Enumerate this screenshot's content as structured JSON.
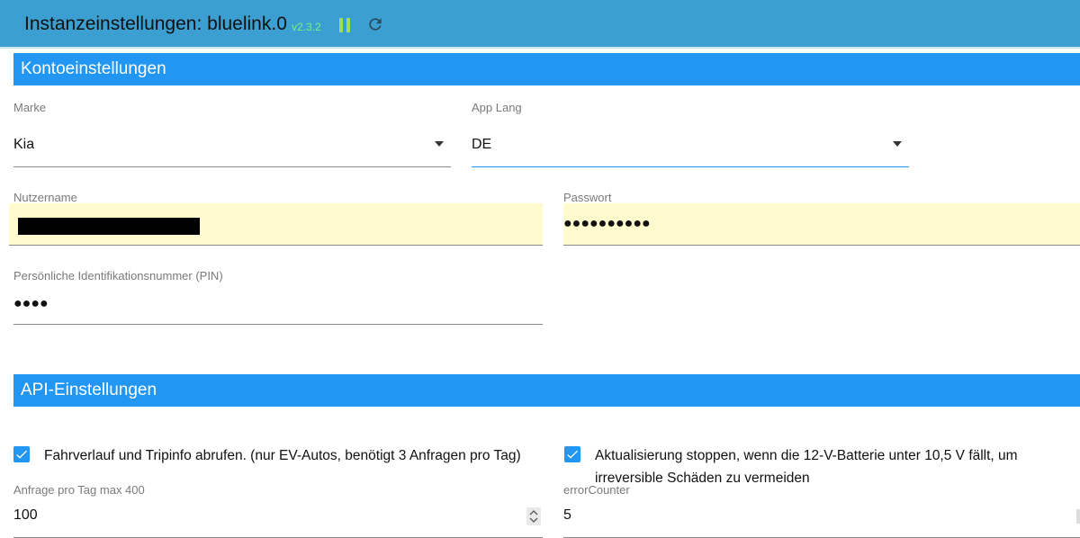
{
  "header": {
    "title": "Instanzeinstellungen: bluelink.0",
    "version": "v2.3.2",
    "colors": {
      "bar": "#3b9fd2",
      "version": "#7cf27c",
      "pause": "#9edf5a"
    }
  },
  "sections": {
    "account": "Kontoeinstellungen",
    "api": "API-Einstellungen"
  },
  "fields": {
    "brand": {
      "label": "Marke",
      "value": "Kia"
    },
    "app_lang": {
      "label": "App Lang",
      "value": "DE"
    },
    "username": {
      "label": "Nutzername",
      "value": ""
    },
    "password": {
      "label": "Passwort",
      "value": "●●●●●●●●●●"
    },
    "pin": {
      "label": "Persönliche Identifikationsnummer (PIN)",
      "value": "●●●●"
    },
    "requests_per_day": {
      "label": "Anfrage pro Tag max 400",
      "value": "100"
    },
    "error_counter": {
      "label": "errorCounter",
      "value": "5"
    }
  },
  "checkboxes": {
    "tripinfo": {
      "label": "Fahrverlauf und Tripinfo abrufen. (nur EV-Autos, benötigt 3 Anfragen pro Tag)",
      "checked": true
    },
    "battery_stop": {
      "label_line1": "Aktualisierung stoppen, wenn die 12-V-Batterie unter 10,5 V fällt, um",
      "label_line2": "irreversible Schäden zu vermeiden",
      "checked": true
    }
  },
  "icons": {
    "pause": "pause-icon",
    "refresh": "refresh-icon",
    "dropdown": "caret-down-icon",
    "check": "check-icon"
  },
  "accent_color": "#2196f3"
}
